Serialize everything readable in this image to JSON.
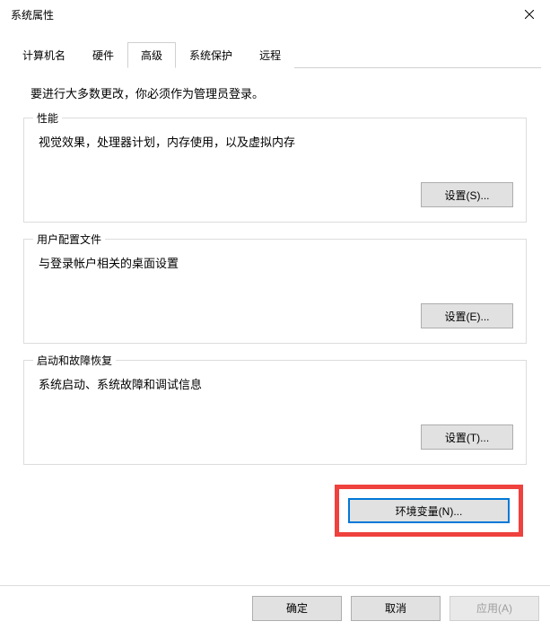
{
  "window": {
    "title": "系统属性"
  },
  "tabs": {
    "items": [
      {
        "label": "计算机名"
      },
      {
        "label": "硬件"
      },
      {
        "label": "高级"
      },
      {
        "label": "系统保护"
      },
      {
        "label": "远程"
      }
    ],
    "active_index": 2
  },
  "intro_text": "要进行大多数更改，你必须作为管理员登录。",
  "groups": {
    "performance": {
      "legend": "性能",
      "desc": "视觉效果，处理器计划，内存使用，以及虚拟内存",
      "button": "设置(S)..."
    },
    "profiles": {
      "legend": "用户配置文件",
      "desc": "与登录帐户相关的桌面设置",
      "button": "设置(E)..."
    },
    "startup": {
      "legend": "启动和故障恢复",
      "desc": "系统启动、系统故障和调试信息",
      "button": "设置(T)..."
    }
  },
  "env_button": "环境变量(N)...",
  "bottom": {
    "ok": "确定",
    "cancel": "取消",
    "apply": "应用(A)"
  }
}
